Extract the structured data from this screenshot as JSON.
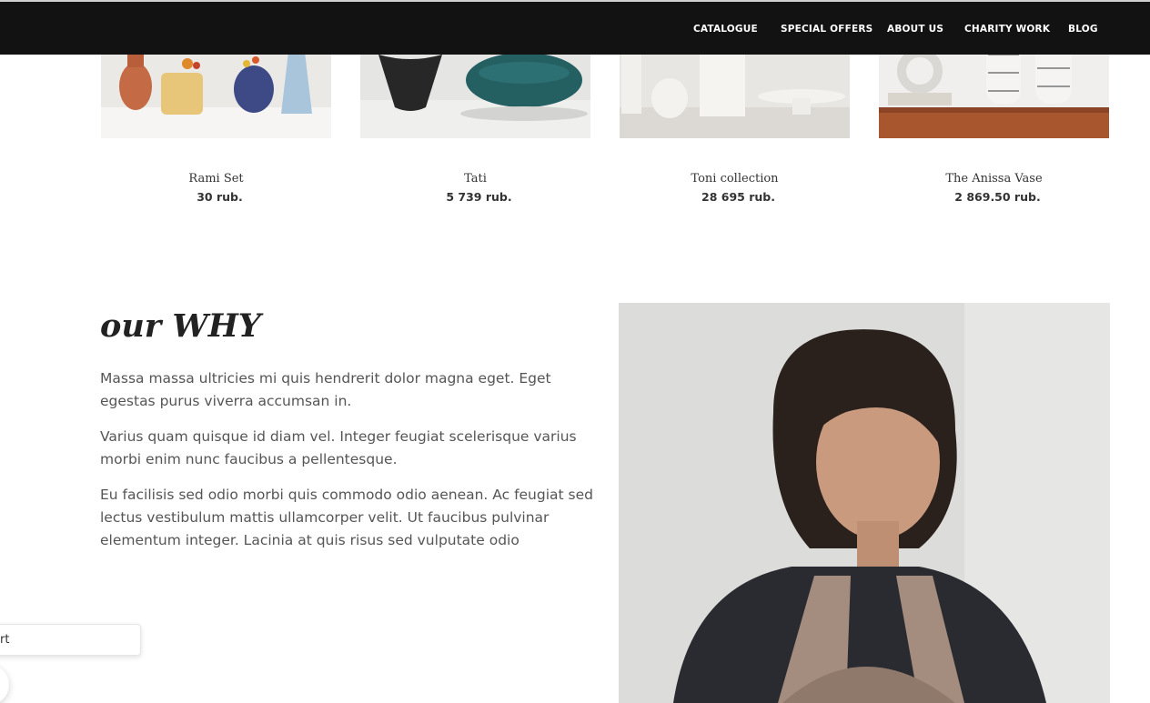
{
  "nav": {
    "items": [
      {
        "label": "CATALOGUE"
      },
      {
        "label": "SPECIAL OFFERS"
      },
      {
        "label": "ABOUT US"
      },
      {
        "label": "CHARITY WORK"
      },
      {
        "label": "BLOG"
      }
    ]
  },
  "products": [
    {
      "name": "Rami Set",
      "price": "30 rub."
    },
    {
      "name": "Tati",
      "price": "5 739 rub."
    },
    {
      "name": "Toni collection",
      "price": "28 695 rub."
    },
    {
      "name": "The Anissa Vase",
      "price": "2 869.50 rub."
    }
  ],
  "why": {
    "title": "our WHY",
    "paragraphs": [
      "Massa massa ultricies mi quis hendrerit dolor magna eget. Eget egestas purus viverra accumsan in.",
      "Varius quam quisque id diam vel. Integer feugiat scelerisque varius morbi enim nunc faucibus a pellentesque.",
      "Eu facilisis sed odio morbi quis commodo odio aenean. Ac feugiat sed lectus vestibulum mattis ullamcorper velit. Ut faucibus pulvinar elementum integer. Lacinia at quis risus sed vulputate odio"
    ]
  },
  "widget": {
    "label": "rt"
  },
  "colors": {
    "header_bg": "#121212",
    "nav_text": "#ffffff",
    "body_text": "#555555",
    "heading_text": "#222222"
  }
}
